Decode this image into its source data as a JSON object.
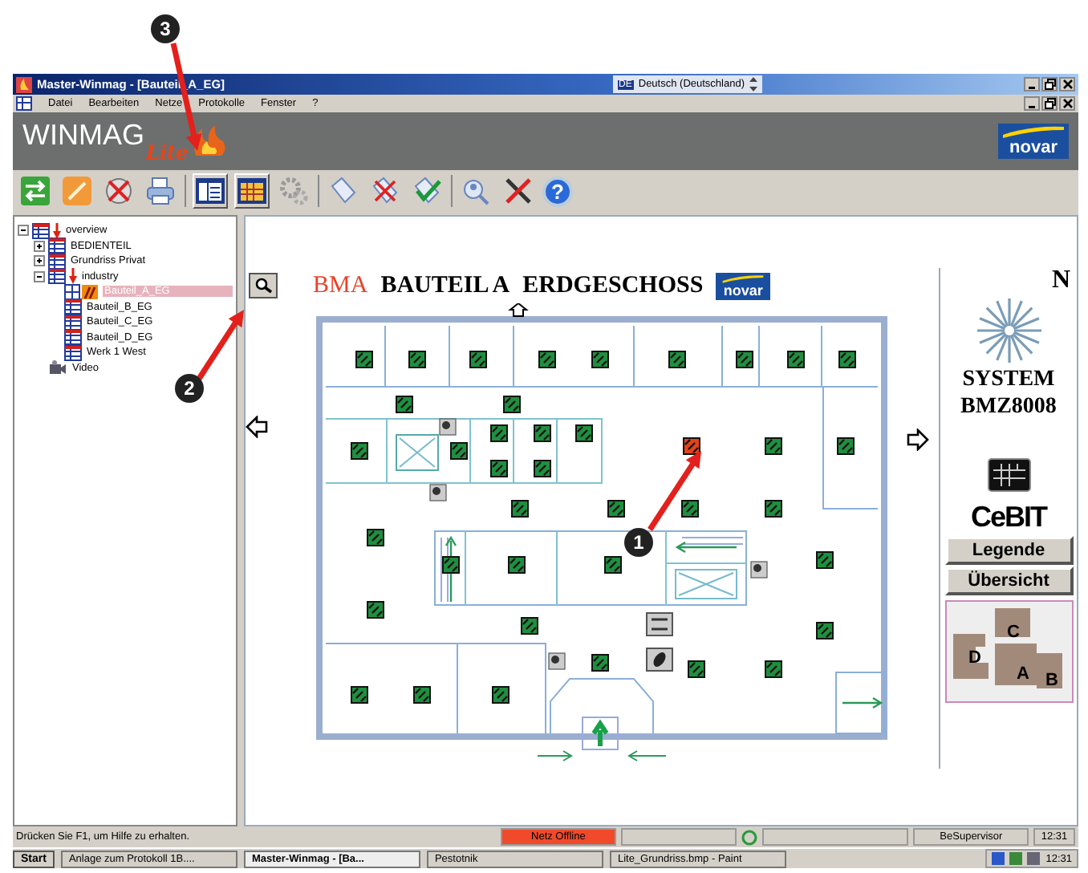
{
  "window": {
    "title": "Master-Winmag - [Bauteil_A_EG]",
    "language_code": "DE",
    "language": "Deutsch (Deutschland)"
  },
  "menu": [
    "Datei",
    "Bearbeiten",
    "Netze",
    "Protokolle",
    "Fenster",
    "?"
  ],
  "banner": {
    "product": "WINMAG",
    "edition": "Lite",
    "brand": "novar"
  },
  "toolbar": {
    "help": "?"
  },
  "tree": [
    {
      "label": "overview",
      "kind": "plan",
      "alarm": true,
      "expanded": true,
      "selected": false,
      "children": [
        {
          "label": "BEDIENTEIL",
          "kind": "plan",
          "alarm": false,
          "expanded": false,
          "selected": false
        },
        {
          "label": "Grundriss Privat",
          "kind": "plan",
          "alarm": false,
          "expanded": false,
          "selected": false
        },
        {
          "label": "industry",
          "kind": "plan",
          "alarm": true,
          "expanded": true,
          "selected": false,
          "children": [
            {
              "label": "Bauteil_A_EG",
              "kind": "alarm",
              "alarm": false,
              "selected": true
            },
            {
              "label": "Bauteil_B_EG",
              "kind": "plan",
              "alarm": false,
              "selected": false
            },
            {
              "label": "Bauteil_C_EG",
              "kind": "plan",
              "alarm": false,
              "selected": false
            },
            {
              "label": "Bauteil_D_EG",
              "kind": "plan",
              "alarm": false,
              "selected": false
            },
            {
              "label": "Werk 1 West",
              "kind": "plan",
              "alarm": false,
              "selected": false
            }
          ]
        },
        {
          "label": "Video",
          "kind": "video",
          "alarm": false,
          "selected": false
        }
      ]
    }
  ],
  "map": {
    "prefix": "BMA",
    "title": "BAUTEIL A",
    "floor": "ERDGESCHOSS",
    "brand": "novar",
    "compass": "N",
    "system": "SYSTEM",
    "model": "BMZ8008",
    "fair": "CeBIT",
    "buttons": [
      "Legende",
      "Übersicht"
    ],
    "overview_letters": [
      "C",
      "D",
      "A",
      "B"
    ],
    "detectors": [
      {
        "alarm": false
      },
      {
        "alarm": false
      },
      {
        "alarm": false
      },
      {
        "alarm": false
      },
      {
        "alarm": false
      },
      {
        "alarm": false
      },
      {
        "alarm": false
      },
      {
        "alarm": false
      },
      {
        "alarm": false
      },
      {
        "alarm": false
      },
      {
        "alarm": false
      },
      {
        "alarm": false
      },
      {
        "alarm": false
      },
      {
        "alarm": false
      },
      {
        "alarm": false
      },
      {
        "alarm": false
      },
      {
        "alarm": false
      },
      {
        "alarm": false
      },
      {
        "alarm": true
      },
      {
        "alarm": false
      },
      {
        "alarm": false
      },
      {
        "alarm": false
      },
      {
        "alarm": false
      },
      {
        "alarm": false
      },
      {
        "alarm": false
      },
      {
        "alarm": false
      },
      {
        "alarm": false
      },
      {
        "alarm": false
      },
      {
        "alarm": false
      },
      {
        "alarm": false
      },
      {
        "alarm": false
      },
      {
        "alarm": false
      },
      {
        "alarm": false
      },
      {
        "alarm": false
      },
      {
        "alarm": false
      },
      {
        "alarm": false
      },
      {
        "alarm": false
      },
      {
        "alarm": false
      },
      {
        "alarm": false
      }
    ]
  },
  "status_bar": {
    "hint": "Drücken Sie F1, um Hilfe zu erhalten.",
    "network": "Netz Offline",
    "network_offline": true,
    "user": "BeSupervisor",
    "time": "12:31"
  },
  "taskbar": {
    "start": "Start",
    "tasks": [
      {
        "label": "Anlage zum Protokoll 1B....",
        "selected": false
      },
      {
        "label": "Master-Winmag - [Ba...",
        "selected": true
      },
      {
        "label": "Pestotnik",
        "selected": false
      },
      {
        "label": "Lite_Grundriss.bmp - Paint",
        "selected": false
      }
    ],
    "time": "12:31"
  },
  "callouts": [
    "1",
    "2",
    "3"
  ]
}
